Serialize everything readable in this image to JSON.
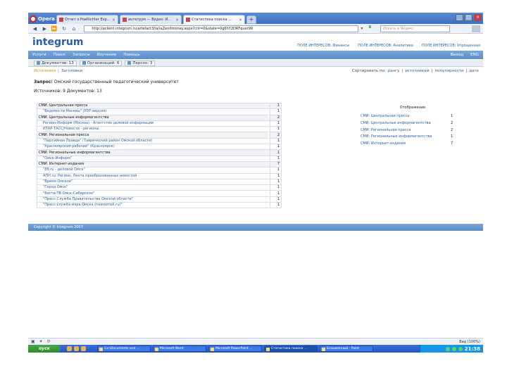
{
  "browser": {
    "logo": "Opera",
    "tabs": [
      {
        "label": "Отчет о PoeRichter Exp...",
        "active": false
      },
      {
        "label": "интегрум — Видео: И...",
        "active": false
      },
      {
        "label": "Статистика поиска ...",
        "active": true
      }
    ],
    "address": "http://aclient.integrum.ru/artefact3/ia/iaZenitmoney.aspx?cnt=0&state=0g6hY2DRFquer99",
    "search_placeholder": "Искать в Яндекс",
    "search_engine": "Я"
  },
  "site": {
    "logo": "integrum",
    "header_links": [
      "ПОЛЕ ИНТЕРЕСОВ: Финансы",
      "ПОЛЕ ИНТЕРЕСОВ: Аналитика",
      "ПОЛЕ ИНТЕРЕСОВ: Упрощенная"
    ],
    "menu": [
      "Услуги",
      "Поиск",
      "Запросы",
      "Изучение",
      "Помощь"
    ],
    "menu_right": [
      "Выход",
      "ENG"
    ],
    "subtabs": [
      "Документов: 13",
      "Организаций: 6",
      "Персон: 3"
    ]
  },
  "main": {
    "view_links": {
      "current": "Источники",
      "other": "Заголовки"
    },
    "sort_label": "Сортировать по:",
    "sort_options": [
      "рангу",
      "источникам",
      "популярности",
      "дате"
    ],
    "query_label": "Запрос:",
    "query_value": "Омский государственный педагогический университет",
    "found_label": "Источников: 9",
    "found_docs": "Документов: 13"
  },
  "results": [
    {
      "type": "group",
      "name": "СМИ: Центральная пресса",
      "count": "1"
    },
    {
      "type": "item",
      "name": "\"Ведомости Москвы\" (PDF-версия)",
      "count": "1"
    },
    {
      "type": "group",
      "name": "СМИ: Центральные информагентства",
      "count": "2"
    },
    {
      "type": "item",
      "name": "Регион-Информ (Москва) - Агентство деловой информации",
      "count": "1"
    },
    {
      "type": "item",
      "name": "ИТАР-ТАСС/Новости - регионы",
      "count": "1"
    },
    {
      "type": "group",
      "name": "СМИ: Региональная пресса",
      "count": "2"
    },
    {
      "type": "item",
      "name": "\"Партийная Правда\" (Таврический район Омской области)",
      "count": "1"
    },
    {
      "type": "item",
      "name": "\"Красноярский рабочий\" (Красноярск)",
      "count": "1"
    },
    {
      "type": "group",
      "name": "СМИ: Региональные информагентства",
      "count": "1"
    },
    {
      "type": "item",
      "name": "\"Омск-Информ\"",
      "count": "1"
    },
    {
      "type": "group",
      "name": "СМИ: Интернет-издания",
      "count": "7"
    },
    {
      "type": "item",
      "name": "\"88.ru - деловой Омск\"",
      "count": "1"
    },
    {
      "type": "item",
      "name": "АПН.ru: Регион. Лента преобразованных новостей",
      "count": "1"
    },
    {
      "type": "item",
      "name": "\"Время Омское\"",
      "count": "1"
    },
    {
      "type": "item",
      "name": "\"Город Омск\"",
      "count": "1"
    },
    {
      "type": "item",
      "name": "\"Вести-ТВ Омск-Сибирское\"",
      "count": "1"
    },
    {
      "type": "item",
      "name": "\"Пресс-Служба Правительства Омской области\"",
      "count": "1"
    },
    {
      "type": "item",
      "name": "\"Пресс-служба мэра Омска (newsomsk.ru)\"",
      "count": "1"
    }
  ],
  "legend": {
    "title": "Отображение",
    "rows": [
      {
        "name": "СМИ: Центральная пресса",
        "count": "1"
      },
      {
        "name": "СМИ: Центральные информагентства",
        "count": "2"
      },
      {
        "name": "СМИ: Региональная пресса",
        "count": "2"
      },
      {
        "name": "СМИ: Региональные информагентства",
        "count": "1"
      },
      {
        "name": "СМИ: Интернет-издания",
        "count": "7"
      }
    ]
  },
  "footer": {
    "text": "Copyright © Integrum 2007"
  },
  "statusbar": {
    "zoom": "Вид (100%)"
  },
  "taskbar": {
    "start": "пуск",
    "tasks": [
      {
        "label": "Cx:\\Documents and ...",
        "active": false
      },
      {
        "label": "Microsoft Word",
        "active": false
      },
      {
        "label": "Microsoft PowerPoint ...",
        "active": false
      },
      {
        "label": "Статистика поиска ...",
        "active": true
      },
      {
        "label": "Безымянный - Paint",
        "active": false
      }
    ],
    "clock": "21:38"
  }
}
